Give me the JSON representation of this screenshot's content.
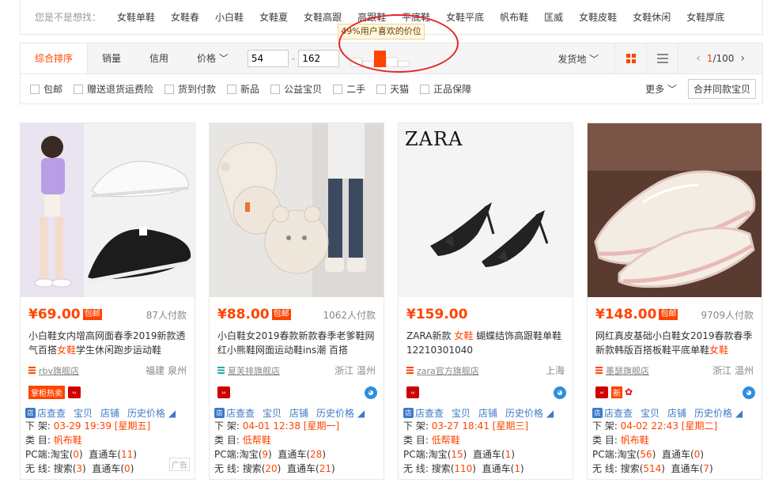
{
  "suggest": {
    "label": "您是不是想找：",
    "keywords": [
      "女鞋单鞋",
      "女鞋春",
      "小白鞋",
      "女鞋夏",
      "女鞋高跟",
      "高跟鞋",
      "平底鞋",
      "女鞋平底",
      "帆布鞋",
      "匡威",
      "女鞋皮鞋",
      "女鞋休闲",
      "女鞋厚底"
    ]
  },
  "sortbar": {
    "tabs": [
      "综合排序",
      "销量",
      "信用",
      "价格 ﹀"
    ],
    "price_min": "54",
    "price_max": "162",
    "price_tip": "49%用户喜欢的价位",
    "price_bar_levels": [
      0.55,
      0.35,
      0.95,
      0.6,
      0.35
    ],
    "active_bar_index": 2,
    "location": "发货地 ﹀",
    "page_current": "1",
    "page_total": "/100"
  },
  "checks": [
    "包邮",
    "赠送退货运费险",
    "货到付款",
    "新品",
    "公益宝贝",
    "二手",
    "天猫",
    "正品保障"
  ],
  "more_label": "更多 ﹀",
  "merge_label": "合并同款宝贝",
  "accent_color": "#ff4400",
  "tool_labels": {
    "dian": "店查查",
    "bao": "宝贝",
    "store": "店铺",
    "history": "历史价格 ◢"
  },
  "info_labels": {
    "shelf": "下 架:",
    "cat": "类 目:",
    "pc": "PC端:",
    "wireless": "无 线:",
    "taobao": "淘宝",
    "ztc": "直通车",
    "search": "搜索"
  },
  "products": [
    {
      "price": "¥69.00",
      "baoyou": "包邮",
      "deals": "87人付款",
      "title_a": "小白鞋女内增高网面春季2019新款透气百搭",
      "title_em": "女鞋",
      "title_b": "学生休闲跑步运动鞋",
      "shop": "rbv旗舰店",
      "location": "福建 泉州",
      "badge_text": "掌柜热卖",
      "shelf": "03-29 19:39 [星期五]",
      "category": "帆布鞋",
      "pc_taobao": "0",
      "pc_ztc": "11",
      "m_search": "3",
      "m_ztc": "0",
      "ad": "广告"
    },
    {
      "price": "¥88.00",
      "baoyou": "包邮",
      "deals": "1062人付款",
      "title_a": "小白鞋女2019春款新款春季老爹鞋网红小熊鞋网面运动鞋ins潮 百搭",
      "title_em": "",
      "title_b": "",
      "shop": "夏芙排旗舰店",
      "location": "浙江 温州",
      "shelf": "04-01 12:38 [星期一]",
      "category": "低帮鞋",
      "pc_taobao": "9",
      "pc_ztc": "28",
      "m_search": "20",
      "m_ztc": "21"
    },
    {
      "price": "¥159.00",
      "baoyou": "",
      "deals": "",
      "title_a": "ZARA新款 ",
      "title_em": "女鞋",
      "title_b": " 蝴蝶结饰高跟鞋单鞋 12210301040",
      "shop": "zara官方旗舰店",
      "location": "上海",
      "shelf": "03-27 18:41 [星期三]",
      "category": "低帮鞋",
      "pc_taobao": "15",
      "pc_ztc": "1",
      "m_search": "110",
      "m_ztc": "1",
      "brand_text": "ZARA"
    },
    {
      "price": "¥148.00",
      "baoyou": "包邮",
      "deals": "9709人付款",
      "title_a": "网红真皮基础小白鞋女2019春款春季新款韩版百搭板鞋平底单鞋",
      "title_em": "女鞋",
      "title_b": "",
      "shop": "墨瑟旗舰店",
      "location": "浙江 温州",
      "badge_new": "新",
      "shelf": "04-02 22:43 [星期二]",
      "category": "帆布鞋",
      "pc_taobao": "56",
      "pc_ztc": "0",
      "m_search": "514",
      "m_ztc": "7"
    }
  ]
}
